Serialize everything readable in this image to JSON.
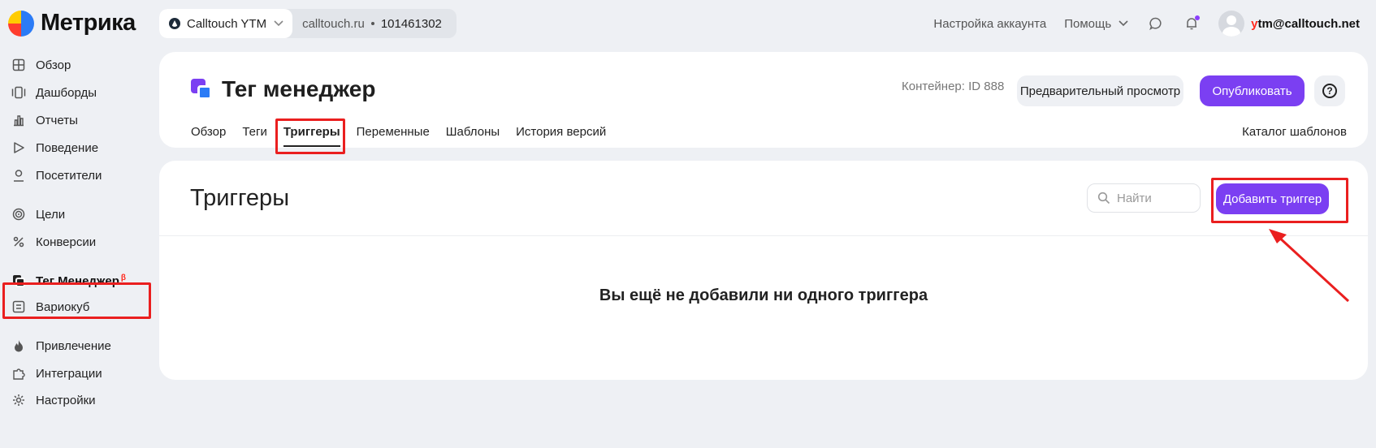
{
  "brand": {
    "logo_text": "Метрика"
  },
  "counter": {
    "name": "Calltouch YTM",
    "site": "calltouch.ru",
    "id": "101461302"
  },
  "topbar": {
    "account_settings": "Настройка аккаунта",
    "help": "Помощь",
    "user_email_first": "y",
    "user_email_rest": "tm@calltouch.net",
    "notification_dot_color": "#8b3ffd"
  },
  "sidebar": {
    "items": [
      {
        "label": "Обзор",
        "icon": "grid-icon"
      },
      {
        "label": "Дашборды",
        "icon": "dashboards-icon"
      },
      {
        "label": "Отчеты",
        "icon": "bar-chart-icon"
      },
      {
        "label": "Поведение",
        "icon": "play-icon"
      },
      {
        "label": "Посетители",
        "icon": "user-icon"
      },
      {
        "label": "Цели",
        "icon": "target-icon"
      },
      {
        "label": "Конверсии",
        "icon": "percent-icon"
      },
      {
        "label": "Тег Менеджер",
        "icon": "tag-manager-icon",
        "badge": "β",
        "active": true
      },
      {
        "label": "Вариокуб",
        "icon": "variocube-icon"
      },
      {
        "label": "Привлечение",
        "icon": "flame-icon"
      },
      {
        "label": "Интеграции",
        "icon": "puzzle-icon"
      },
      {
        "label": "Настройки",
        "icon": "gear-icon"
      }
    ]
  },
  "header": {
    "title": "Тег менеджер",
    "container": "Контейнер: ID 888",
    "preview_button": "Предварительный просмотр",
    "publish_button": "Опубликовать",
    "tabs": [
      "Обзор",
      "Теги",
      "Триггеры",
      "Переменные",
      "Шаблоны",
      "История версий"
    ],
    "active_tab": "Триггеры",
    "catalog_link": "Каталог шаблонов"
  },
  "main": {
    "title": "Триггеры",
    "search_placeholder": "Найти",
    "add_button": "Добавить триггер",
    "empty_message": "Вы ещё не добавили ни одного триггера"
  },
  "colors": {
    "accent": "#7b3ff2",
    "annotation": "#ea1f1f",
    "background": "#eef0f4"
  }
}
